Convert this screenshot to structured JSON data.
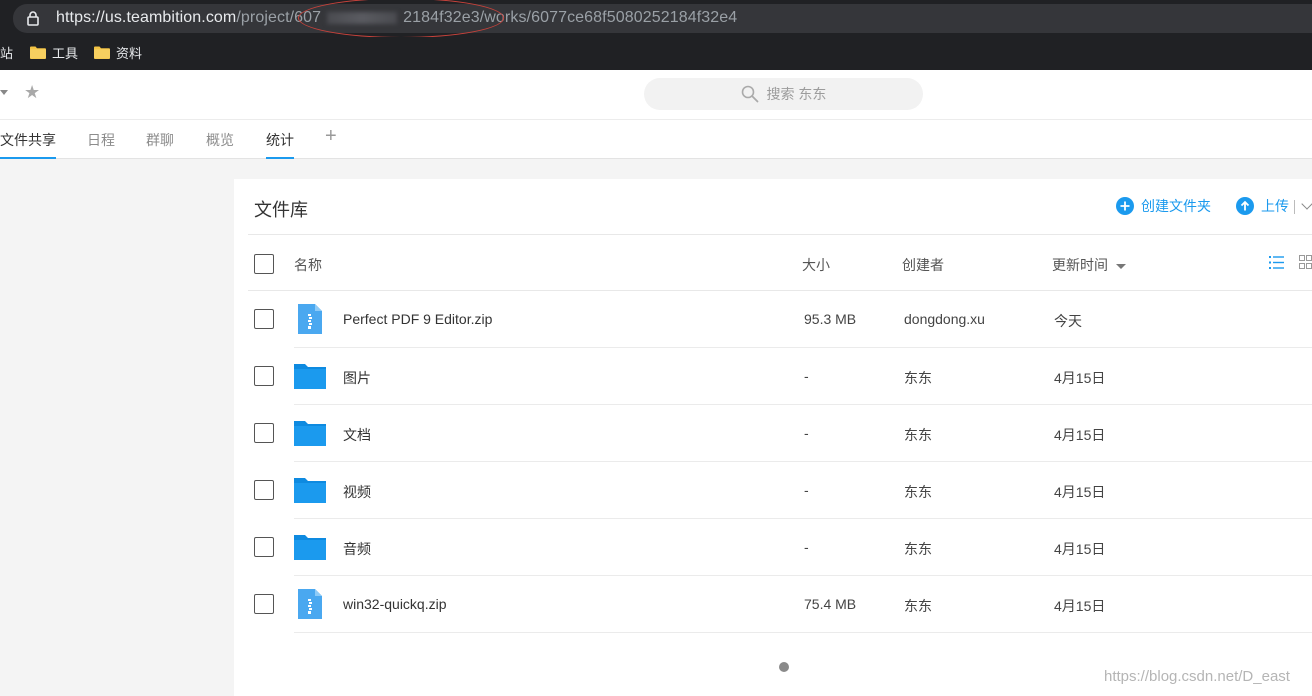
{
  "browser": {
    "url_host": "https://us.teambition.com",
    "url_path_start": "/project/607",
    "url_path_mid": "2184f32e3",
    "url_path_end": "/works/6077ce68f5080252184f32e4",
    "bookmarks": [
      {
        "label": "站",
        "icon": "none"
      },
      {
        "label": "工具",
        "icon": "folder-icon"
      },
      {
        "label": "资料",
        "icon": "folder-icon"
      }
    ]
  },
  "header": {
    "search_placeholder": "搜索 东东"
  },
  "tabs": [
    {
      "label": "文件共享",
      "active": true
    },
    {
      "label": "日程",
      "active": false
    },
    {
      "label": "群聊",
      "active": false
    },
    {
      "label": "概览",
      "active": false
    },
    {
      "label": "统计",
      "active": true
    }
  ],
  "library": {
    "title": "文件库",
    "create_folder_label": "创建文件夹",
    "upload_label": "上传",
    "columns": {
      "name": "名称",
      "size": "大小",
      "creator": "创建者",
      "updated": "更新时间"
    },
    "files": [
      {
        "icon": "zip-file-icon",
        "name": "Perfect PDF 9 Editor.zip",
        "size": "95.3 MB",
        "creator": "dongdong.xu",
        "updated": "今天"
      },
      {
        "icon": "folder-icon",
        "name": "图片",
        "size": "-",
        "creator": "东东",
        "updated": "4月15日"
      },
      {
        "icon": "folder-icon",
        "name": "文档",
        "size": "-",
        "creator": "东东",
        "updated": "4月15日"
      },
      {
        "icon": "folder-icon",
        "name": "视频",
        "size": "-",
        "creator": "东东",
        "updated": "4月15日"
      },
      {
        "icon": "folder-icon",
        "name": "音频",
        "size": "-",
        "creator": "东东",
        "updated": "4月15日"
      },
      {
        "icon": "zip-file-icon",
        "name": "win32-quickq.zip",
        "size": "75.4 MB",
        "creator": "东东",
        "updated": "4月15日"
      }
    ]
  },
  "watermark": "https://blog.csdn.net/D_east",
  "colors": {
    "accent": "#1b9aee",
    "folder": "#1b9aee",
    "zip": "#4aa8f0",
    "chrome_dark": "#202124"
  }
}
